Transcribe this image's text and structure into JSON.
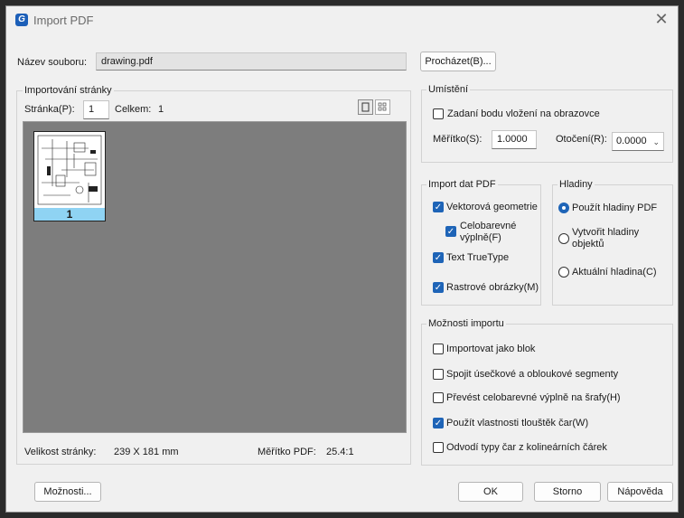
{
  "window": {
    "title": "Import PDF",
    "app_icon": "G"
  },
  "file": {
    "label": "Název souboru:",
    "value": "drawing.pdf",
    "browse_label": "Procházet(B)..."
  },
  "pages": {
    "group_title": "Importování stránky",
    "page_label": "Stránka(P):",
    "page_value": "1",
    "total_label": "Celkem:",
    "total_value": "1",
    "thumbnail_label": "1",
    "size_label": "Velikost stránky:",
    "size_value": "239 X 181 mm",
    "scale_label": "Měřítko PDF:",
    "scale_value": "25.4:1"
  },
  "placement": {
    "group_title": "Umístění",
    "insertion_label": "Zadaní bodu vložení na obrazovce",
    "insertion_checked": false,
    "scale_label": "Měřítko(S):",
    "scale_value": "1.0000",
    "rotation_label": "Otočení(R):",
    "rotation_value": "0.0000"
  },
  "pdf_data": {
    "group_title": "Import dat PDF",
    "vector_label": "Vektorová geometrie",
    "fill_label_line1": "Celobarevné",
    "fill_label_line2": "výplně(F)",
    "truetype_label": "Text TrueType",
    "raster_label": "Rastrové obrázky(M)"
  },
  "layers": {
    "group_title": "Hladiny",
    "use_pdf_label": "Použít hladiny PDF",
    "create_label_line1": "Vytvořit hladiny",
    "create_label_line2": "objektů",
    "current_label": "Aktuální hladina(C)"
  },
  "import_options": {
    "group_title": "Možnosti importu",
    "as_block_label": "Importovat jako blok",
    "join_label": "Spojit úsečkové a obloukové segmenty",
    "convert_fill_label": "Převést celobarevné výplně na šrafy(H)",
    "lineweight_label": "Použít vlastnosti tlouštěk čar(W)",
    "infer_label": "Odvodí typy čar z kolineárních čárek"
  },
  "buttons": {
    "options": "Možnosti...",
    "ok": "OK",
    "cancel": "Storno",
    "help": "Nápověda"
  },
  "colors": {
    "accent": "#1e64b7",
    "thumb_label_bg": "#8fd3f3",
    "preview_bg": "#7d7d7d"
  }
}
